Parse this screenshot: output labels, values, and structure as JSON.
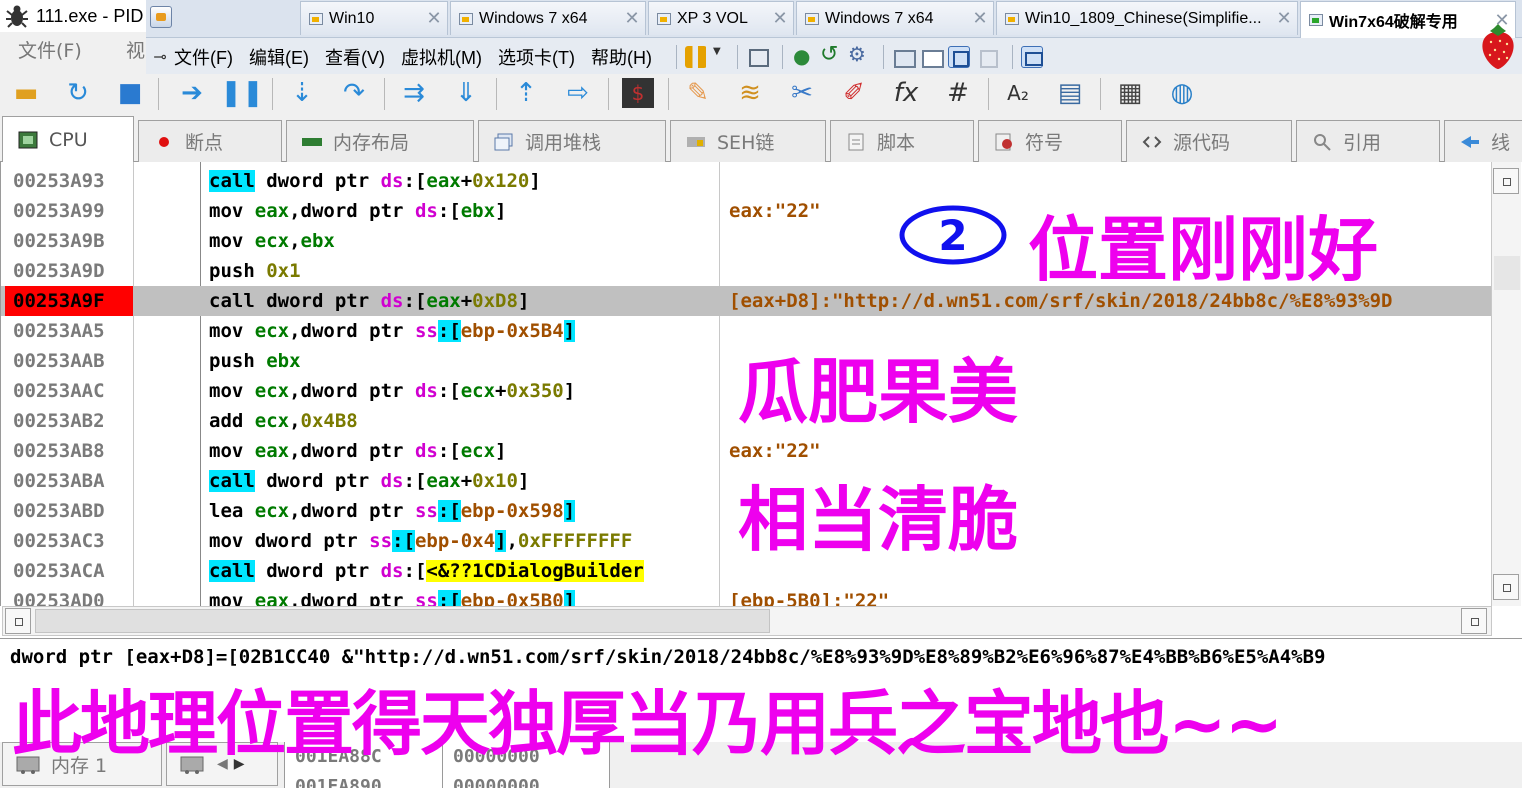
{
  "window": {
    "title": "111.exe - PID"
  },
  "vm_tabs": [
    {
      "label": "Win10",
      "active": false
    },
    {
      "label": "Windows 7 x64",
      "active": false
    },
    {
      "label": "XP 3 VOL",
      "active": false
    },
    {
      "label": "Windows 7 x64",
      "active": false
    },
    {
      "label": "Win10_1809_Chinese(Simplifie...",
      "active": false
    },
    {
      "label": "Win7x64破解专用",
      "active": true
    }
  ],
  "vm_tab_close": "✕",
  "debugger_menu": {
    "file": "文件(F)",
    "view_partial": "视"
  },
  "vm_menu": [
    "文件(F)",
    "编辑(E)",
    "查看(V)",
    "虚拟机(M)",
    "选项卡(T)",
    "帮助(H)"
  ],
  "view_tabs": [
    "CPU",
    "断点",
    "内存布局",
    "调用堆栈",
    "SEH链",
    "脚本",
    "符号",
    "源代码",
    "引用",
    "线"
  ],
  "disasm": [
    {
      "addr": "00253A93",
      "ins": [
        [
          "mnem hl",
          "call"
        ],
        [
          "kw",
          " dword ptr "
        ],
        [
          "seg",
          "ds"
        ],
        [
          "brk",
          ":["
        ],
        [
          "reg",
          "eax"
        ],
        [
          "brk",
          "+"
        ],
        [
          "num",
          "0x120"
        ],
        [
          "brk",
          "]"
        ]
      ],
      "cmt": ""
    },
    {
      "addr": "00253A99",
      "ins": [
        [
          "mnem",
          "mov "
        ],
        [
          "reg",
          "eax"
        ],
        [
          "brk",
          ","
        ],
        [
          "kw",
          "dword ptr "
        ],
        [
          "seg",
          "ds"
        ],
        [
          "brk",
          ":["
        ],
        [
          "reg",
          "ebx"
        ],
        [
          "brk",
          "]"
        ]
      ],
      "cmt": "eax:\"22\""
    },
    {
      "addr": "00253A9B",
      "ins": [
        [
          "mnem",
          "mov "
        ],
        [
          "reg",
          "ecx"
        ],
        [
          "brk",
          ","
        ],
        [
          "reg",
          "ebx"
        ]
      ],
      "cmt": ""
    },
    {
      "addr": "00253A9D",
      "ins": [
        [
          "mnem",
          "push "
        ],
        [
          "num",
          "0x1"
        ]
      ],
      "cmt": ""
    },
    {
      "addr": "00253A9F",
      "sel": true,
      "ins": [
        [
          "mnem",
          "call"
        ],
        [
          "kw",
          " dword ptr "
        ],
        [
          "seg",
          "ds"
        ],
        [
          "brk",
          ":["
        ],
        [
          "reg",
          "eax"
        ],
        [
          "brk",
          "+"
        ],
        [
          "num",
          "0xD8"
        ],
        [
          "brk",
          "]"
        ]
      ],
      "cmt": "[eax+D8]:\"http://d.wn51.com/srf/skin/2018/24bb8c/%E8%93%9D"
    },
    {
      "addr": "00253AA5",
      "ins": [
        [
          "mnem",
          "mov "
        ],
        [
          "reg",
          "ecx"
        ],
        [
          "brk",
          ","
        ],
        [
          "kw",
          "dword ptr "
        ],
        [
          "seg",
          "ss"
        ],
        [
          "brk hl",
          ":["
        ],
        [
          "mem",
          "ebp-0x5B4"
        ],
        [
          "brk hl",
          "]"
        ]
      ],
      "cmt": ""
    },
    {
      "addr": "00253AAB",
      "ins": [
        [
          "mnem",
          "push "
        ],
        [
          "reg",
          "ebx"
        ]
      ],
      "cmt": ""
    },
    {
      "addr": "00253AAC",
      "ins": [
        [
          "mnem",
          "mov "
        ],
        [
          "reg",
          "ecx"
        ],
        [
          "brk",
          ","
        ],
        [
          "kw",
          "dword ptr "
        ],
        [
          "seg",
          "ds"
        ],
        [
          "brk",
          ":["
        ],
        [
          "reg",
          "ecx"
        ],
        [
          "brk",
          "+"
        ],
        [
          "num",
          "0x350"
        ],
        [
          "brk",
          "]"
        ]
      ],
      "cmt": ""
    },
    {
      "addr": "00253AB2",
      "ins": [
        [
          "mnem",
          "add "
        ],
        [
          "reg",
          "ecx"
        ],
        [
          "brk",
          ","
        ],
        [
          "num",
          "0x4B8"
        ]
      ],
      "cmt": ""
    },
    {
      "addr": "00253AB8",
      "ins": [
        [
          "mnem",
          "mov "
        ],
        [
          "reg",
          "eax"
        ],
        [
          "brk",
          ","
        ],
        [
          "kw",
          "dword ptr "
        ],
        [
          "seg",
          "ds"
        ],
        [
          "brk",
          ":["
        ],
        [
          "reg",
          "ecx"
        ],
        [
          "brk",
          "]"
        ]
      ],
      "cmt": "eax:\"22\""
    },
    {
      "addr": "00253ABA",
      "ins": [
        [
          "mnem hl",
          "call"
        ],
        [
          "kw",
          " dword ptr "
        ],
        [
          "seg",
          "ds"
        ],
        [
          "brk",
          ":["
        ],
        [
          "reg",
          "eax"
        ],
        [
          "brk",
          "+"
        ],
        [
          "num",
          "0x10"
        ],
        [
          "brk",
          "]"
        ]
      ],
      "cmt": ""
    },
    {
      "addr": "00253ABD",
      "ins": [
        [
          "mnem",
          "lea "
        ],
        [
          "reg",
          "ecx"
        ],
        [
          "brk",
          ","
        ],
        [
          "kw",
          "dword ptr "
        ],
        [
          "seg",
          "ss"
        ],
        [
          "brk hl",
          ":["
        ],
        [
          "mem",
          "ebp-0x598"
        ],
        [
          "brk hl",
          "]"
        ]
      ],
      "cmt": ""
    },
    {
      "addr": "00253AC3",
      "ins": [
        [
          "mnem",
          "mov "
        ],
        [
          "kw",
          "dword ptr "
        ],
        [
          "seg",
          "ss"
        ],
        [
          "brk hl",
          ":["
        ],
        [
          "mem",
          "ebp-0x4"
        ],
        [
          "brk hl",
          "]"
        ],
        [
          "brk",
          ","
        ],
        [
          "num",
          "0xFFFFFFFF"
        ]
      ],
      "cmt": ""
    },
    {
      "addr": "00253ACA",
      "ins": [
        [
          "mnem hl",
          "call"
        ],
        [
          "kw",
          " dword ptr "
        ],
        [
          "seg",
          "ds"
        ],
        [
          "brk",
          ":["
        ],
        [
          "call-tgt",
          "<&??1CDialogBuilder"
        ]
      ],
      "cmt": ""
    },
    {
      "addr": "00253AD0",
      "ins": [
        [
          "mnem",
          "mov "
        ],
        [
          "reg",
          "eax"
        ],
        [
          "brk",
          ","
        ],
        [
          "kw",
          "dword ptr "
        ],
        [
          "seg",
          "ss"
        ],
        [
          "brk hl",
          ":["
        ],
        [
          "mem",
          "ebp-0x5B0"
        ],
        [
          "brk hl",
          "]"
        ]
      ],
      "cmt": "[ebp-5B0]:\"22\""
    }
  ],
  "info_line": "dword ptr [eax+D8]=[02B1CC40 &\"http://d.wn51.com/srf/skin/2018/24bb8c/%E8%93%9D%E8%89%B2%E6%96%87%E4%BB%B6%E5%A4%B9",
  "bottom_tabs": [
    "内存 1"
  ],
  "dump": {
    "addr": [
      "001EA88C",
      "001EA890"
    ],
    "val": [
      "00000000",
      "00000000"
    ]
  },
  "annotations": {
    "circle_number": "2",
    "a1": "位置刚刚好",
    "a2": "瓜肥果美",
    "a3": "相当清脆",
    "a4": "此地理位置得天独厚当乃用兵之宝地也~~"
  },
  "colors": {
    "annotation": "#ee00ee",
    "selected_addr": "#ff0000",
    "highlight": "#00e5ff",
    "call_target": "#ffff00"
  }
}
